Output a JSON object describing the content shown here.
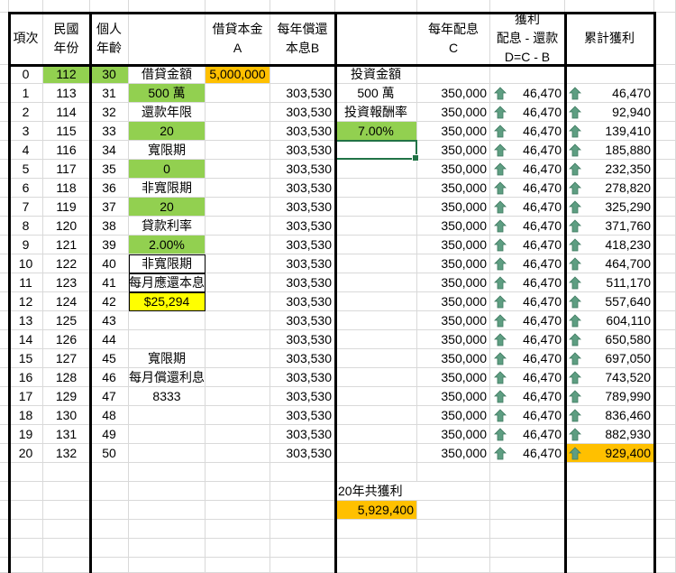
{
  "colors": {
    "green": "#92D050",
    "orange": "#FFC000",
    "yellow": "#FFFF00",
    "arrow": "#5E9E82",
    "selection": "#217346"
  },
  "header": {
    "item": "項次",
    "year": [
      "民國",
      "年份"
    ],
    "age": [
      "個人",
      "年齡"
    ],
    "note": [],
    "loan": [
      "借貸本金",
      "A"
    ],
    "repay": [
      "每年償還",
      "本息B"
    ],
    "inv": [],
    "div": [
      "每年配息",
      "C"
    ],
    "profit": [
      "獲利",
      "配息 - 還款",
      "D=C - B"
    ],
    "cum": [
      "累計獲利"
    ]
  },
  "rows": [
    {
      "item": "0",
      "year": "112",
      "age": "30",
      "note": "借貸金額",
      "loan": "5,000,000",
      "repay": "",
      "inv": "投資金額",
      "div": "",
      "profit": "",
      "cum": "",
      "fills": {
        "year": "green",
        "age": "green",
        "loan": "orange"
      }
    },
    {
      "item": "1",
      "year": "113",
      "age": "31",
      "note": "500 萬",
      "repay": "303,530",
      "inv": "500 萬",
      "div": "350,000",
      "profit": "46,470",
      "cum": "46,470",
      "fills": {
        "note": "green"
      }
    },
    {
      "item": "2",
      "year": "114",
      "age": "32",
      "note": "還款年限",
      "repay": "303,530",
      "inv": "投資報酬率",
      "div": "350,000",
      "profit": "46,470",
      "cum": "92,940"
    },
    {
      "item": "3",
      "year": "115",
      "age": "33",
      "note": "20",
      "repay": "303,530",
      "inv": "7.00%",
      "div": "350,000",
      "profit": "46,470",
      "cum": "139,410",
      "fills": {
        "note": "green",
        "inv": "green"
      }
    },
    {
      "item": "4",
      "year": "116",
      "age": "34",
      "note": "寬限期",
      "repay": "303,530",
      "inv": "",
      "div": "350,000",
      "profit": "46,470",
      "cum": "185,880",
      "selected": "inv"
    },
    {
      "item": "5",
      "year": "117",
      "age": "35",
      "note": "0",
      "repay": "303,530",
      "div": "350,000",
      "profit": "46,470",
      "cum": "232,350",
      "fills": {
        "note": "green"
      }
    },
    {
      "item": "6",
      "year": "118",
      "age": "36",
      "note": "非寬限期",
      "repay": "303,530",
      "div": "350,000",
      "profit": "46,470",
      "cum": "278,820"
    },
    {
      "item": "7",
      "year": "119",
      "age": "37",
      "note": "20",
      "repay": "303,530",
      "div": "350,000",
      "profit": "46,470",
      "cum": "325,290",
      "fills": {
        "note": "green"
      }
    },
    {
      "item": "8",
      "year": "120",
      "age": "38",
      "note": "貸款利率",
      "repay": "303,530",
      "div": "350,000",
      "profit": "46,470",
      "cum": "371,760"
    },
    {
      "item": "9",
      "year": "121",
      "age": "39",
      "note": "2.00%",
      "repay": "303,530",
      "div": "350,000",
      "profit": "46,470",
      "cum": "418,230",
      "fills": {
        "note": "green"
      }
    },
    {
      "item": "10",
      "year": "122",
      "age": "40",
      "note": "非寬限期",
      "repay": "303,530",
      "div": "350,000",
      "profit": "46,470",
      "cum": "464,700",
      "boxed": "note"
    },
    {
      "item": "11",
      "year": "123",
      "age": "41",
      "note": "每月應還本息",
      "repay": "303,530",
      "div": "350,000",
      "profit": "46,470",
      "cum": "511,170",
      "boxed": "note"
    },
    {
      "item": "12",
      "year": "124",
      "age": "42",
      "note": "$25,294",
      "repay": "303,530",
      "div": "350,000",
      "profit": "46,470",
      "cum": "557,640",
      "fills": {
        "note": "yellow"
      },
      "boxed": "note"
    },
    {
      "item": "13",
      "year": "125",
      "age": "43",
      "note": "",
      "repay": "303,530",
      "div": "350,000",
      "profit": "46,470",
      "cum": "604,110"
    },
    {
      "item": "14",
      "year": "126",
      "age": "44",
      "note": "",
      "repay": "303,530",
      "div": "350,000",
      "profit": "46,470",
      "cum": "650,580"
    },
    {
      "item": "15",
      "year": "127",
      "age": "45",
      "note": "寬限期",
      "repay": "303,530",
      "div": "350,000",
      "profit": "46,470",
      "cum": "697,050"
    },
    {
      "item": "16",
      "year": "128",
      "age": "46",
      "note": "每月償還利息",
      "repay": "303,530",
      "div": "350,000",
      "profit": "46,470",
      "cum": "743,520"
    },
    {
      "item": "17",
      "year": "129",
      "age": "47",
      "note": "8333",
      "repay": "303,530",
      "div": "350,000",
      "profit": "46,470",
      "cum": "789,990"
    },
    {
      "item": "18",
      "year": "130",
      "age": "48",
      "note": "",
      "repay": "303,530",
      "div": "350,000",
      "profit": "46,470",
      "cum": "836,460"
    },
    {
      "item": "19",
      "year": "131",
      "age": "49",
      "note": "",
      "repay": "303,530",
      "div": "350,000",
      "profit": "46,470",
      "cum": "882,930"
    },
    {
      "item": "20",
      "year": "132",
      "age": "50",
      "note": "",
      "repay": "303,530",
      "div": "350,000",
      "profit": "46,470",
      "cum": "929,400",
      "fills": {
        "cum": "orange"
      }
    }
  ],
  "total": {
    "label": "20年共獲利",
    "value": "5,929,400",
    "fill": "orange"
  },
  "icons": {
    "trend": "arrow-up-icon"
  }
}
